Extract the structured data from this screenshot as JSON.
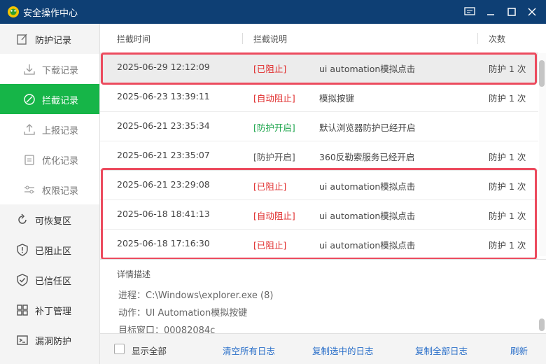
{
  "window": {
    "title": "安全操作中心",
    "icons": [
      "logo-icon",
      "feedback-icon",
      "minimize-icon",
      "maximize-icon",
      "close-icon"
    ]
  },
  "sidebar": {
    "items": [
      {
        "label": "防护记录",
        "icon": "edit-icon"
      },
      {
        "label": "下载记录",
        "icon": "download-icon"
      },
      {
        "label": "拦截记录",
        "icon": "block-icon"
      },
      {
        "label": "上报记录",
        "icon": "upload-icon"
      },
      {
        "label": "优化记录",
        "icon": "clipboard-icon"
      },
      {
        "label": "权限记录",
        "icon": "sliders-icon"
      },
      {
        "label": "可恢复区",
        "icon": "restore-icon"
      },
      {
        "label": "已阻止区",
        "icon": "shield-alert-icon"
      },
      {
        "label": "已信任区",
        "icon": "shield-check-icon"
      },
      {
        "label": "补丁管理",
        "icon": "grid-icon"
      },
      {
        "label": "漏洞防护",
        "icon": "terminal-icon"
      }
    ]
  },
  "table": {
    "headers": {
      "time": "拦截时间",
      "desc": "拦截说明",
      "count": "次数"
    },
    "rows": [
      {
        "time": "2025-06-29 12:12:09",
        "tag": "[已阻止]",
        "desc": "ui automation模拟点击",
        "count": "防护 1 次"
      },
      {
        "time": "2025-06-23 13:39:11",
        "tag": "[自动阻止]",
        "desc": "模拟按键",
        "count": "防护 1 次"
      },
      {
        "time": "2025-06-21 23:35:34",
        "tag": "[防护开启]",
        "desc": "默认浏览器防护已经开启",
        "count": ""
      },
      {
        "time": "2025-06-21 23:35:07",
        "tag": "[防护开启]",
        "desc": "360反勒索服务已经开启",
        "count": "防护 1 次"
      },
      {
        "time": "2025-06-21 23:29:08",
        "tag": "[已阻止]",
        "desc": "ui automation模拟点击",
        "count": "防护 1 次"
      },
      {
        "time": "2025-06-18 18:41:13",
        "tag": "[自动阻止]",
        "desc": "ui automation模拟点击",
        "count": "防护 1 次"
      },
      {
        "time": "2025-06-18 17:16:30",
        "tag": "[已阻止]",
        "desc": "ui automation模拟点击",
        "count": "防护 1 次"
      }
    ]
  },
  "detail": {
    "title": "详情描述",
    "process": "进程：C:\\Windows\\explorer.exe (8)",
    "action": "动作：UI Automation模拟按键",
    "target": "目标窗口：00082084c"
  },
  "footer": {
    "show_all": "显示全部",
    "clear_all": "清空所有日志",
    "copy_selected": "复制选中的日志",
    "copy_all": "复制全部日志",
    "refresh": "刷新"
  },
  "colors": {
    "titlebar": "#0e3f74",
    "active": "#16b548",
    "highlight": "#ec4b5e",
    "blocked": "#e02b2b",
    "enabled": "#1aa34a",
    "link": "#2a6fc9"
  }
}
